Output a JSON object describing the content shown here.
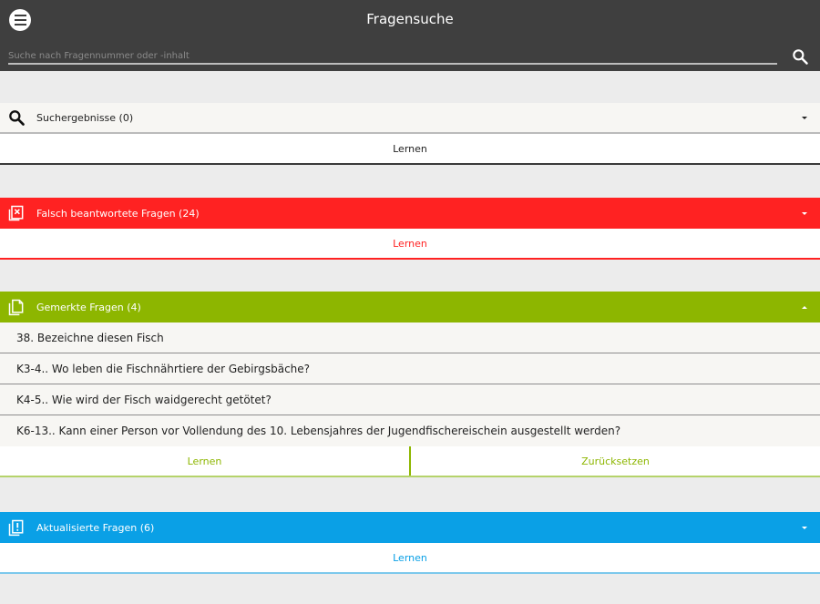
{
  "appbar": {
    "title": "Fragensuche",
    "search_placeholder": "Suche nach Fragennummer oder -inhalt",
    "search_value": ""
  },
  "sections": {
    "search": {
      "title": "Suchergebnisse (0)",
      "learn": "Lernen",
      "color": "#222222"
    },
    "wrong": {
      "title": "Falsch beantwortete Fragen (24)",
      "learn": "Lernen",
      "color": "#ff2222"
    },
    "marked": {
      "title": "Gemerkte Fragen (4)",
      "learn": "Lernen",
      "reset": "Zurücksetzen",
      "color": "#8db600",
      "items": [
        "38. Bezeichne diesen Fisch",
        "K3-4.. Wo leben die Fischnährtiere der Gebirgsbäche?",
        "K4-5.. Wie wird der Fisch waidgerecht getötet?",
        "K6-13.. Kann einer Person vor Vollendung des 10. Lebensjahres der Jugendfischereischein ausgestellt werden?"
      ]
    },
    "updated": {
      "title": "Aktualisierte Fragen (6)",
      "learn": "Lernen",
      "color": "#0aa0e6"
    }
  }
}
